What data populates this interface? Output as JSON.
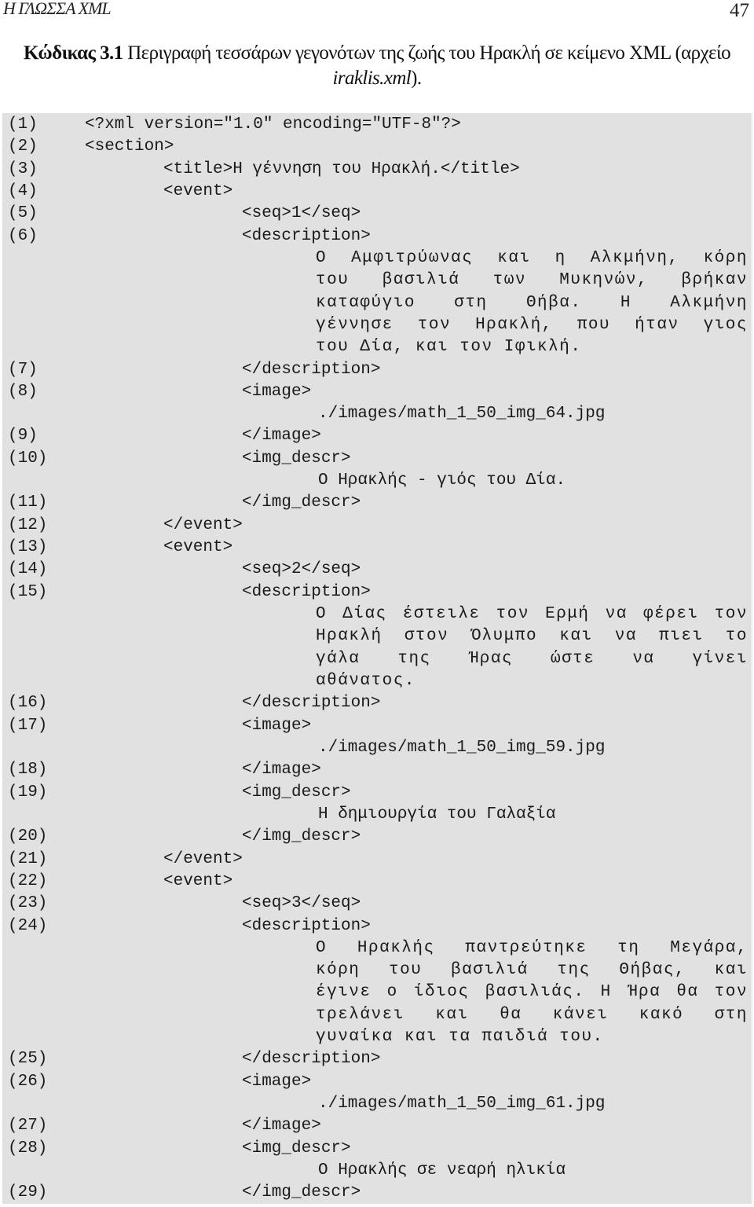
{
  "header": {
    "running_title": "Η ΓΛΩΣΣΑ XML",
    "page_number": "47"
  },
  "caption": {
    "label": "Κώδικας 3.1",
    "text": " Περιγραφή τεσσάρων γεγονότων της ζωής του Ηρακλή σε κείμενο XML (αρχείο ",
    "filename": "iraklis.xml",
    "suffix": ")."
  },
  "code_listing": {
    "lines": [
      {
        "n": "(1)",
        "indent": 1,
        "text": "<?xml version=\"1.0\" encoding=\"UTF-8\"?>"
      },
      {
        "n": "(2)",
        "indent": 1,
        "text": "<section>"
      },
      {
        "n": "(3)",
        "indent": 2,
        "text": "<title>Η γέννηση του Ηρακλή.</title>"
      },
      {
        "n": "(4)",
        "indent": 2,
        "text": "<event>"
      },
      {
        "n": "(5)",
        "indent": 3,
        "text": "<seq>1</seq>"
      },
      {
        "n": "(6)",
        "indent": 3,
        "text": "<description>"
      },
      {
        "n": "",
        "indent": 4,
        "justify": true,
        "text": "Ο Αμφιτρύωνας και η Αλκμήνη, κόρη"
      },
      {
        "n": "",
        "indent": 4,
        "justify": true,
        "text": "του βασιλιά των Μυκηνών, βρήκαν"
      },
      {
        "n": "",
        "indent": 4,
        "justify": true,
        "text": "καταφύγιο στη Θήβα. Η Αλκμήνη"
      },
      {
        "n": "",
        "indent": 4,
        "justify": true,
        "text": "γέννησε τον Ηρακλή, που ήταν γιος"
      },
      {
        "n": "",
        "indent": 4,
        "justify": false,
        "text": "του Δία, και τον Ιφικλή."
      },
      {
        "n": "(7)",
        "indent": 3,
        "text": "</description>"
      },
      {
        "n": "(8)",
        "indent": 3,
        "text": "<image>"
      },
      {
        "n": "",
        "indent": 5,
        "text": "./images/math_1_50_img_64.jpg"
      },
      {
        "n": "(9)",
        "indent": 3,
        "text": "</image>"
      },
      {
        "n": "(10)",
        "indent": 3,
        "text": "<img_descr>"
      },
      {
        "n": "",
        "indent": 5,
        "text": "Ο Ηρακλής - γιός του Δία."
      },
      {
        "n": "(11)",
        "indent": 3,
        "text": "</img_descr>"
      },
      {
        "n": "(12)",
        "indent": 2,
        "text": "</event>"
      },
      {
        "n": "(13)",
        "indent": 2,
        "text": "<event>"
      },
      {
        "n": "(14)",
        "indent": 3,
        "text": "<seq>2</seq>"
      },
      {
        "n": "(15)",
        "indent": 3,
        "text": "<description>"
      },
      {
        "n": "",
        "indent": 4,
        "justify": true,
        "text": "Ο Δίας έστειλε τον Ερμή να φέρει τον"
      },
      {
        "n": "",
        "indent": 4,
        "justify": true,
        "text": "Ηρακλή στον Όλυμπο και να πιει το"
      },
      {
        "n": "",
        "indent": 4,
        "justify": true,
        "text": "γάλα της Ήρας ώστε να γίνει"
      },
      {
        "n": "",
        "indent": 4,
        "justify": false,
        "text": "αθάνατος."
      },
      {
        "n": "(16)",
        "indent": 3,
        "text": "</description>"
      },
      {
        "n": "(17)",
        "indent": 3,
        "text": "<image>"
      },
      {
        "n": "",
        "indent": 5,
        "text": "./images/math_1_50_img_59.jpg"
      },
      {
        "n": "(18)",
        "indent": 3,
        "text": "</image>"
      },
      {
        "n": "(19)",
        "indent": 3,
        "text": "<img_descr>"
      },
      {
        "n": "",
        "indent": 5,
        "text": "Η δημιουργία του Γαλαξία"
      },
      {
        "n": "(20)",
        "indent": 3,
        "text": "</img_descr>"
      },
      {
        "n": "(21)",
        "indent": 2,
        "text": "</event>"
      },
      {
        "n": "(22)",
        "indent": 2,
        "text": "<event>"
      },
      {
        "n": "(23)",
        "indent": 3,
        "text": "<seq>3</seq>"
      },
      {
        "n": "(24)",
        "indent": 3,
        "text": "<description>"
      },
      {
        "n": "",
        "indent": 4,
        "justify": true,
        "text": "Ο Ηρακλής παντρεύτηκε τη Μεγάρα,"
      },
      {
        "n": "",
        "indent": 4,
        "justify": true,
        "text": "κόρη του βασιλιά της Θήβας, και"
      },
      {
        "n": "",
        "indent": 4,
        "justify": true,
        "text": "έγινε ο ίδιος βασιλιάς. Η Ήρα θα τον"
      },
      {
        "n": "",
        "indent": 4,
        "justify": true,
        "text": "τρελάνει και θα κάνει κακό στη"
      },
      {
        "n": "",
        "indent": 4,
        "justify": false,
        "text": "γυναίκα και τα παιδιά του."
      },
      {
        "n": "(25)",
        "indent": 3,
        "text": "</description>"
      },
      {
        "n": "(26)",
        "indent": 3,
        "text": "<image>"
      },
      {
        "n": "",
        "indent": 5,
        "text": "./images/math_1_50_img_61.jpg"
      },
      {
        "n": "(27)",
        "indent": 3,
        "text": "</image>"
      },
      {
        "n": "(28)",
        "indent": 3,
        "text": "<img_descr>"
      },
      {
        "n": "",
        "indent": 5,
        "text": "Ο Ηρακλής σε νεαρή ηλικία"
      },
      {
        "n": "(29)",
        "indent": 3,
        "text": "</img_descr>"
      }
    ]
  }
}
